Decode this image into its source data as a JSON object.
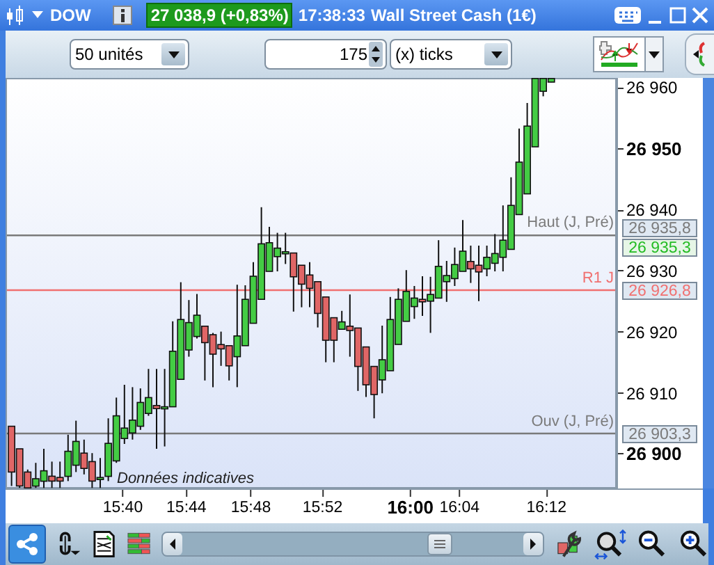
{
  "title_bar": {
    "instrument": "DOW",
    "price_badge": "27 038,9 (+0,83%)",
    "time": "17:38:33",
    "name": "Wall Street Cash (1€)"
  },
  "toolbar": {
    "units_select": "50 unités",
    "tick_count": "175",
    "ticks_select": "(x) ticks"
  },
  "chart": {
    "notice": "Données indicatives",
    "levels": [
      {
        "kind": "reference",
        "label": "Haut (J, Pré)",
        "value": "26 935,8",
        "color": "#7a7a7a"
      },
      {
        "kind": "current",
        "value": "26 935,3",
        "color": "#22bb22"
      },
      {
        "kind": "reference",
        "label": "R1 J",
        "value": "26 926,8",
        "color": "#f07070"
      },
      {
        "kind": "reference",
        "label": "Ouv (J, Pré)",
        "value": "26 903,3",
        "color": "#7a7a7a"
      }
    ],
    "chart_data": {
      "type": "candlestick",
      "categories": [
        null,
        null,
        null,
        null,
        null,
        null,
        null,
        null,
        null,
        null,
        null,
        null,
        null,
        null,
        null,
        null,
        null,
        null,
        null,
        null,
        null,
        null,
        null,
        null,
        null,
        null,
        null,
        null,
        null,
        null,
        null,
        null,
        null,
        null,
        null,
        null,
        null,
        null,
        null,
        null,
        null,
        null,
        null,
        null,
        null,
        null,
        null,
        null,
        null,
        null,
        null,
        null,
        null,
        null,
        null,
        null,
        null,
        null,
        null,
        null,
        null,
        null,
        null,
        null,
        null,
        null,
        null,
        null
      ],
      "ohlc": [
        [
          26904.5,
          26904.5,
          26894.7,
          26897.0
        ],
        [
          26900.8,
          26900.8,
          26894.4,
          26894.7
        ],
        [
          26897.0,
          26897.4,
          26894.4,
          26894.4
        ],
        [
          26894.7,
          26898.5,
          26894.4,
          26895.9
        ],
        [
          26895.5,
          26900.8,
          26894.4,
          26897.2
        ],
        [
          26896.3,
          26898.7,
          26894.4,
          26895.5
        ],
        [
          26896.1,
          26898.7,
          26894.4,
          26895.5
        ],
        [
          26896.3,
          26903.1,
          26895.5,
          26900.4
        ],
        [
          26898.1,
          26905.4,
          26897.0,
          26902.0
        ],
        [
          26900.1,
          26902.3,
          26896.6,
          26897.6
        ],
        [
          26898.7,
          26900.1,
          26894.4,
          26895.5
        ],
        [
          26895.8,
          26899.3,
          26894.4,
          26896.1
        ],
        [
          26896.3,
          26905.8,
          26895.5,
          26901.7
        ],
        [
          26898.8,
          26909.2,
          26898.5,
          26906.2
        ],
        [
          26902.5,
          26911.3,
          26901.6,
          26904.2
        ],
        [
          26903.4,
          26910.9,
          26902.3,
          26905.5
        ],
        [
          26904.5,
          26910.7,
          26903.9,
          26908.4
        ],
        [
          26906.6,
          26913.9,
          26906.2,
          26909.2
        ],
        [
          26907.9,
          26913.9,
          26900.8,
          26907.4
        ],
        [
          26907.6,
          26913.9,
          26901.2,
          26907.7
        ],
        [
          26907.7,
          26921.7,
          26907.7,
          26916.8
        ],
        [
          26912.2,
          26928.1,
          26912.2,
          26922.0
        ],
        [
          26917.0,
          26925.2,
          26915.9,
          26921.5
        ],
        [
          26919.2,
          26926.2,
          26918.9,
          26922.7
        ],
        [
          26920.9,
          26920.9,
          26912.0,
          26918.2
        ],
        [
          26919.5,
          26919.8,
          26910.9,
          26916.3
        ],
        [
          26917.9,
          26920.0,
          26914.4,
          26917.2
        ],
        [
          26917.7,
          26917.7,
          26912.0,
          26914.4
        ],
        [
          26915.9,
          26927.7,
          26910.9,
          26919.3
        ],
        [
          26917.7,
          26927.6,
          26917.7,
          26925.3
        ],
        [
          26921.4,
          26931.4,
          26921.4,
          26929.1
        ],
        [
          26925.3,
          26940.4,
          26925.3,
          26934.4
        ],
        [
          26929.9,
          26937.2,
          26929.9,
          26934.6
        ],
        [
          26932.3,
          26936.2,
          26929.9,
          26933.7
        ],
        [
          26932.9,
          26936.2,
          26931.1,
          26933.1
        ],
        [
          26932.9,
          26932.9,
          26923.3,
          26929.0
        ],
        [
          26930.9,
          26930.9,
          26924.0,
          26927.8
        ],
        [
          26929.3,
          26931.4,
          26924.0,
          26927.1
        ],
        [
          26928.2,
          26928.2,
          26920.7,
          26923.0
        ],
        [
          26925.7,
          26925.7,
          26915.0,
          26918.6
        ],
        [
          26922.3,
          26922.3,
          26915.0,
          26918.6
        ],
        [
          26920.4,
          26923.4,
          26920.4,
          26921.6
        ],
        [
          26920.9,
          26926.1,
          26915.9,
          26920.2
        ],
        [
          26920.6,
          26920.6,
          26910.3,
          26914.3
        ],
        [
          26917.5,
          26917.5,
          26909.3,
          26911.3
        ],
        [
          26914.3,
          26914.3,
          26905.8,
          26909.7
        ],
        [
          26912.1,
          26921.0,
          26909.9,
          26915.4
        ],
        [
          26913.6,
          26925.7,
          26913.6,
          26922.0
        ],
        [
          26917.9,
          26927.1,
          26917.9,
          26925.3
        ],
        [
          26921.7,
          26930.1,
          26921.7,
          26926.6
        ],
        [
          26924.1,
          26927.5,
          26922.1,
          26925.5
        ],
        [
          26925.3,
          26929.1,
          26922.6,
          26924.9
        ],
        [
          26925.0,
          26929.0,
          26919.8,
          26926.1
        ],
        [
          26925.5,
          26935.0,
          26925.5,
          26930.7
        ],
        [
          26928.2,
          26931.6,
          26924.9,
          26929.2
        ],
        [
          26928.7,
          26933.8,
          26927.5,
          26931.0
        ],
        [
          26929.9,
          26938.3,
          26929.9,
          26933.2
        ],
        [
          26931.5,
          26934.1,
          26928.0,
          26930.3
        ],
        [
          26930.9,
          26934.1,
          26925.0,
          26929.8
        ],
        [
          26930.3,
          26934.1,
          26929.1,
          26932.2
        ],
        [
          26931.2,
          26936.0,
          26929.9,
          26932.8
        ],
        [
          26932.2,
          26940.7,
          26929.9,
          26935.0
        ],
        [
          26933.5,
          26945.3,
          26933.5,
          26940.7
        ],
        [
          26939.2,
          26953.3,
          26939.2,
          26947.8
        ],
        [
          26942.6,
          26957.5,
          26942.6,
          26953.7
        ],
        [
          26950.3,
          26961.5,
          26950.3,
          26961.5
        ],
        [
          26959.4,
          26961.5,
          26958.6,
          26961.5
        ],
        [
          26960.9,
          26961.5,
          26960.9,
          26961.5
        ]
      ],
      "ref_lines": [
        {
          "axis": "y",
          "value": 26935.8,
          "color": "#7a7a7a"
        },
        {
          "axis": "y",
          "value": 26926.8,
          "color": "#f07070"
        },
        {
          "axis": "y",
          "value": 26903.3,
          "color": "#7a7a7a"
        }
      ],
      "ylim": [
        26894.3,
        26961.6
      ],
      "yticks": [
        {
          "value": 26960,
          "label": "26 960"
        },
        {
          "value": 26950,
          "label": "26 950"
        },
        {
          "value": 26940,
          "label": "26 940"
        },
        {
          "value": 26930,
          "label": "26 930"
        },
        {
          "value": 26920,
          "label": "26 920"
        },
        {
          "value": 26910,
          "label": "26 910"
        },
        {
          "value": 26900,
          "label": "26 900"
        }
      ]
    },
    "ytick_bold": [
      false,
      true,
      false,
      false,
      false,
      false,
      true
    ],
    "time_labels": [
      {
        "label": "15:40",
        "major": false
      },
      {
        "label": "15:44",
        "major": false
      },
      {
        "label": "15:48",
        "major": false
      },
      {
        "label": "15:52",
        "major": false
      },
      {
        "label": "16:00",
        "major": true
      },
      {
        "label": "16:04",
        "major": false
      },
      {
        "label": "16:12",
        "major": false
      }
    ]
  }
}
